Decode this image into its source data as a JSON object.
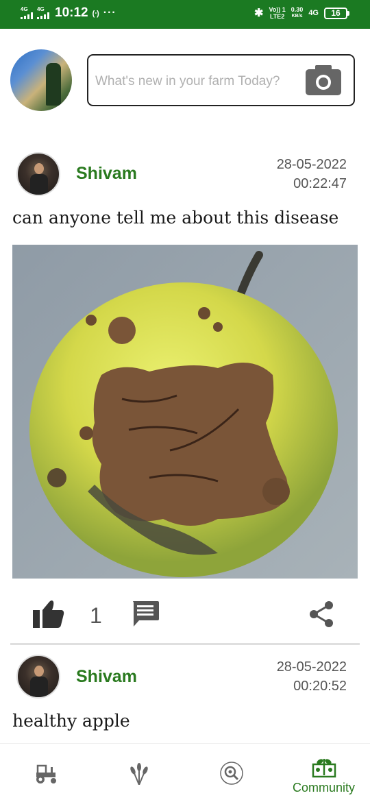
{
  "status_bar": {
    "net1": "4G",
    "net2": "4G",
    "time": "10:12",
    "hotspot": "(ᐧ)",
    "dots": "···",
    "bluetooth": "✱",
    "volte_top": "Vo)) 1",
    "volte_bottom": "LTE2",
    "speed_value": "0.30",
    "speed_unit": "KB/s",
    "net3": "4G",
    "battery": "16"
  },
  "composer": {
    "placeholder": "What's new in your farm Today?"
  },
  "posts": [
    {
      "author": "Shivam",
      "date": "28-05-2022",
      "time": "00:22:47",
      "text": "can anyone tell me about this disease",
      "likes": "1"
    },
    {
      "author": "Shivam",
      "date": "28-05-2022",
      "time": "00:20:52",
      "text": "healthy apple"
    }
  ],
  "nav": {
    "community_label": "Community",
    "items": [
      "tractor-icon",
      "wheat-icon",
      "crop-scan-icon",
      "community-icon"
    ]
  },
  "colors": {
    "brand_green": "#1b7a22",
    "name_green": "#2a7a1f"
  }
}
